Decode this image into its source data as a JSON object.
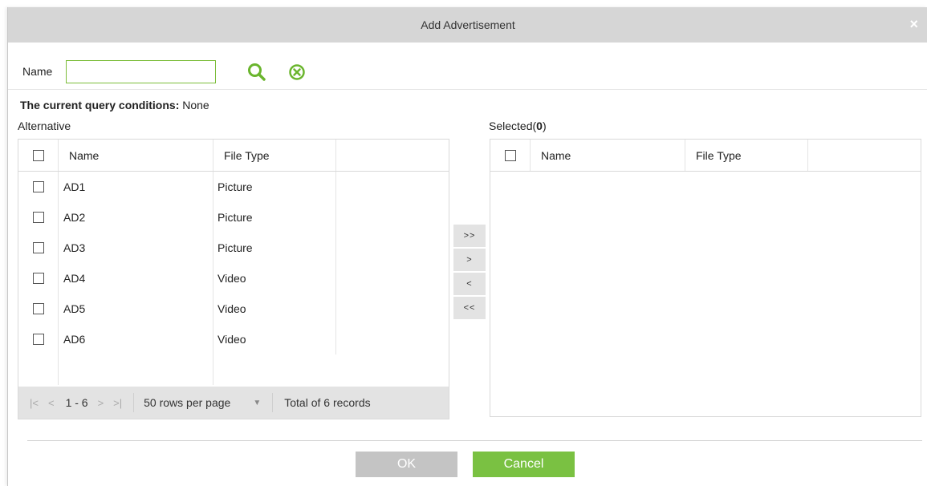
{
  "dialog": {
    "title": "Add Advertisement",
    "close": "×"
  },
  "search": {
    "label": "Name",
    "value": "",
    "placeholder": ""
  },
  "query": {
    "prefix": "The current query conditions:",
    "value": "None"
  },
  "alternative": {
    "label": "Alternative",
    "headers": {
      "name": "Name",
      "file_type": "File Type"
    },
    "rows": [
      {
        "name": "AD1",
        "file_type": "Picture"
      },
      {
        "name": "AD2",
        "file_type": "Picture"
      },
      {
        "name": "AD3",
        "file_type": "Picture"
      },
      {
        "name": "AD4",
        "file_type": "Video"
      },
      {
        "name": "AD5",
        "file_type": "Video"
      },
      {
        "name": "AD6",
        "file_type": "Video"
      }
    ],
    "pager": {
      "first": "|<",
      "prev": "<",
      "range": "1 - 6",
      "next": ">",
      "last": ">|",
      "rows_per_page": "50 rows per page",
      "total": "Total of 6 records"
    }
  },
  "selected": {
    "label_prefix": "Selected(",
    "count": "0",
    "label_suffix": ")",
    "headers": {
      "name": "Name",
      "file_type": "File Type"
    }
  },
  "move_buttons": {
    "add_all": ">>",
    "add": ">",
    "remove": "<",
    "remove_all": "<<"
  },
  "footer": {
    "ok": "OK",
    "cancel": "Cancel"
  },
  "colors": {
    "accent_green": "#7ac142",
    "titlebar_bg": "#d6d6d6",
    "disabled_button": "#c4c4c4",
    "search_icon": "#6ab52d",
    "clear_icon": "#6ab52d"
  },
  "icons": {
    "search": "search-icon",
    "clear": "clear-circle-icon",
    "close": "close-icon"
  }
}
